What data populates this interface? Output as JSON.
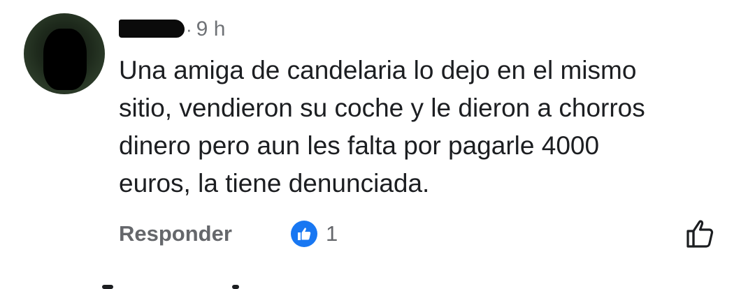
{
  "comment": {
    "author_redacted": true,
    "timestamp": "9 h",
    "separator": "·",
    "text": "Una amiga de candelaria lo dejo en el mismo\nsitio, vendieron su coche y le dieron a chorros\ndinero pero aun les falta por pagarle 4000\neuros, la tiene denunciada."
  },
  "actions": {
    "reply_label": "Responder",
    "reaction_icon": "like-icon",
    "reaction_count": "1",
    "like_button_icon": "thumbs-up-outline-icon"
  },
  "colors": {
    "text": "#1c1e21",
    "secondary": "#65676b",
    "meta": "#6f7276",
    "like_blue": "#1877f2",
    "background": "#ffffff"
  }
}
